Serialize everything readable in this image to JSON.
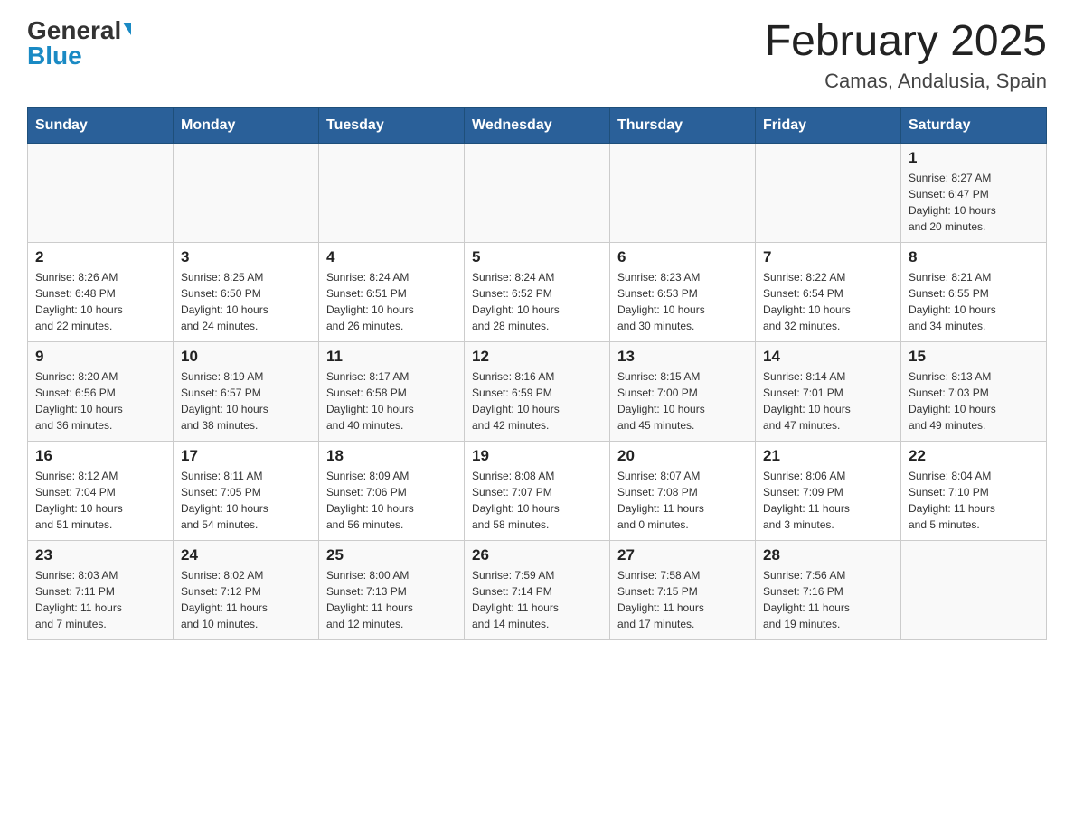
{
  "logo": {
    "general": "General",
    "blue": "Blue"
  },
  "title": "February 2025",
  "location": "Camas, Andalusia, Spain",
  "days_of_week": [
    "Sunday",
    "Monday",
    "Tuesday",
    "Wednesday",
    "Thursday",
    "Friday",
    "Saturday"
  ],
  "weeks": [
    [
      {
        "day": "",
        "info": ""
      },
      {
        "day": "",
        "info": ""
      },
      {
        "day": "",
        "info": ""
      },
      {
        "day": "",
        "info": ""
      },
      {
        "day": "",
        "info": ""
      },
      {
        "day": "",
        "info": ""
      },
      {
        "day": "1",
        "info": "Sunrise: 8:27 AM\nSunset: 6:47 PM\nDaylight: 10 hours\nand 20 minutes."
      }
    ],
    [
      {
        "day": "2",
        "info": "Sunrise: 8:26 AM\nSunset: 6:48 PM\nDaylight: 10 hours\nand 22 minutes."
      },
      {
        "day": "3",
        "info": "Sunrise: 8:25 AM\nSunset: 6:50 PM\nDaylight: 10 hours\nand 24 minutes."
      },
      {
        "day": "4",
        "info": "Sunrise: 8:24 AM\nSunset: 6:51 PM\nDaylight: 10 hours\nand 26 minutes."
      },
      {
        "day": "5",
        "info": "Sunrise: 8:24 AM\nSunset: 6:52 PM\nDaylight: 10 hours\nand 28 minutes."
      },
      {
        "day": "6",
        "info": "Sunrise: 8:23 AM\nSunset: 6:53 PM\nDaylight: 10 hours\nand 30 minutes."
      },
      {
        "day": "7",
        "info": "Sunrise: 8:22 AM\nSunset: 6:54 PM\nDaylight: 10 hours\nand 32 minutes."
      },
      {
        "day": "8",
        "info": "Sunrise: 8:21 AM\nSunset: 6:55 PM\nDaylight: 10 hours\nand 34 minutes."
      }
    ],
    [
      {
        "day": "9",
        "info": "Sunrise: 8:20 AM\nSunset: 6:56 PM\nDaylight: 10 hours\nand 36 minutes."
      },
      {
        "day": "10",
        "info": "Sunrise: 8:19 AM\nSunset: 6:57 PM\nDaylight: 10 hours\nand 38 minutes."
      },
      {
        "day": "11",
        "info": "Sunrise: 8:17 AM\nSunset: 6:58 PM\nDaylight: 10 hours\nand 40 minutes."
      },
      {
        "day": "12",
        "info": "Sunrise: 8:16 AM\nSunset: 6:59 PM\nDaylight: 10 hours\nand 42 minutes."
      },
      {
        "day": "13",
        "info": "Sunrise: 8:15 AM\nSunset: 7:00 PM\nDaylight: 10 hours\nand 45 minutes."
      },
      {
        "day": "14",
        "info": "Sunrise: 8:14 AM\nSunset: 7:01 PM\nDaylight: 10 hours\nand 47 minutes."
      },
      {
        "day": "15",
        "info": "Sunrise: 8:13 AM\nSunset: 7:03 PM\nDaylight: 10 hours\nand 49 minutes."
      }
    ],
    [
      {
        "day": "16",
        "info": "Sunrise: 8:12 AM\nSunset: 7:04 PM\nDaylight: 10 hours\nand 51 minutes."
      },
      {
        "day": "17",
        "info": "Sunrise: 8:11 AM\nSunset: 7:05 PM\nDaylight: 10 hours\nand 54 minutes."
      },
      {
        "day": "18",
        "info": "Sunrise: 8:09 AM\nSunset: 7:06 PM\nDaylight: 10 hours\nand 56 minutes."
      },
      {
        "day": "19",
        "info": "Sunrise: 8:08 AM\nSunset: 7:07 PM\nDaylight: 10 hours\nand 58 minutes."
      },
      {
        "day": "20",
        "info": "Sunrise: 8:07 AM\nSunset: 7:08 PM\nDaylight: 11 hours\nand 0 minutes."
      },
      {
        "day": "21",
        "info": "Sunrise: 8:06 AM\nSunset: 7:09 PM\nDaylight: 11 hours\nand 3 minutes."
      },
      {
        "day": "22",
        "info": "Sunrise: 8:04 AM\nSunset: 7:10 PM\nDaylight: 11 hours\nand 5 minutes."
      }
    ],
    [
      {
        "day": "23",
        "info": "Sunrise: 8:03 AM\nSunset: 7:11 PM\nDaylight: 11 hours\nand 7 minutes."
      },
      {
        "day": "24",
        "info": "Sunrise: 8:02 AM\nSunset: 7:12 PM\nDaylight: 11 hours\nand 10 minutes."
      },
      {
        "day": "25",
        "info": "Sunrise: 8:00 AM\nSunset: 7:13 PM\nDaylight: 11 hours\nand 12 minutes."
      },
      {
        "day": "26",
        "info": "Sunrise: 7:59 AM\nSunset: 7:14 PM\nDaylight: 11 hours\nand 14 minutes."
      },
      {
        "day": "27",
        "info": "Sunrise: 7:58 AM\nSunset: 7:15 PM\nDaylight: 11 hours\nand 17 minutes."
      },
      {
        "day": "28",
        "info": "Sunrise: 7:56 AM\nSunset: 7:16 PM\nDaylight: 11 hours\nand 19 minutes."
      },
      {
        "day": "",
        "info": ""
      }
    ]
  ]
}
